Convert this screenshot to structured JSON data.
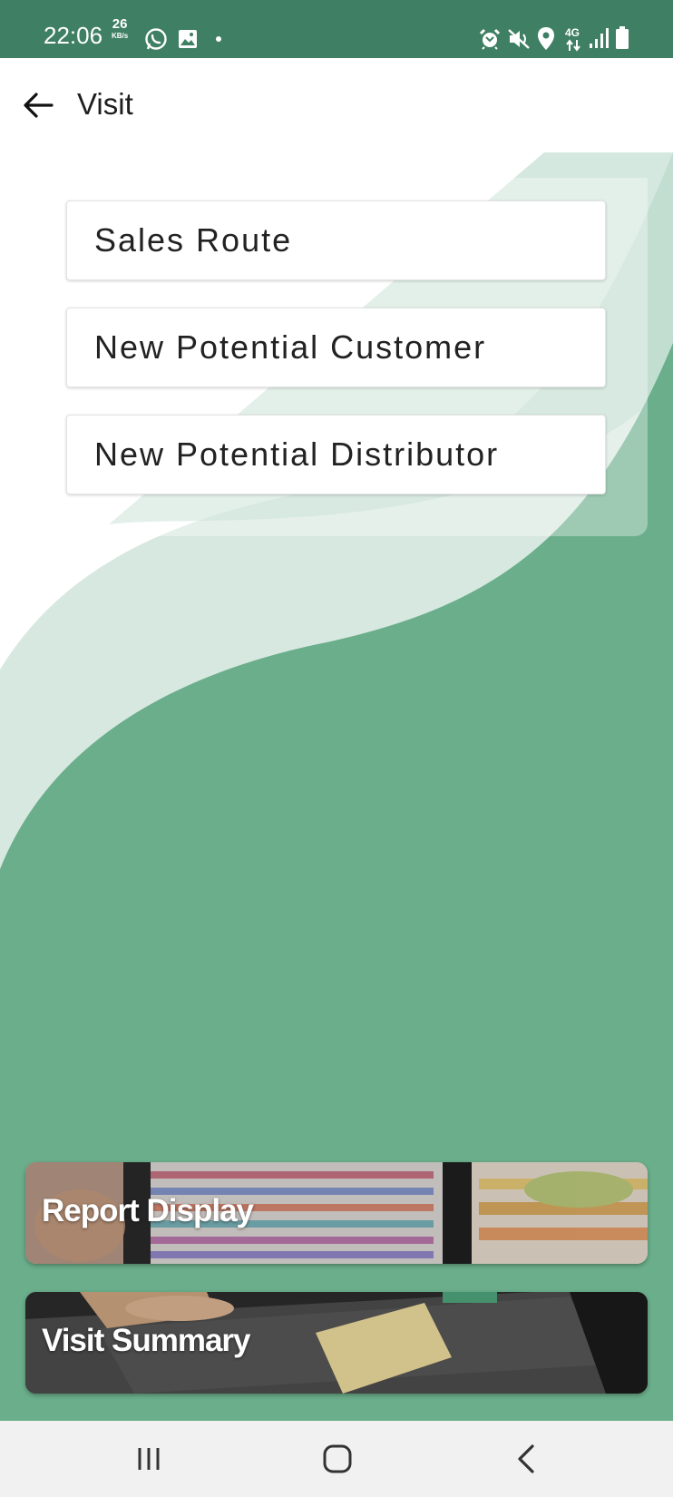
{
  "status_bar": {
    "time": "22:06",
    "net_speed_value": "26",
    "net_speed_unit": "KB/s",
    "left_icons": [
      "whatsapp-icon",
      "gallery-icon",
      "dot-icon"
    ],
    "right_icons": [
      "alarm-icon",
      "mute-icon",
      "location-icon",
      "4g-icon",
      "signal-icon",
      "battery-icon"
    ],
    "network_label": "4G"
  },
  "header": {
    "title": "Visit",
    "back_icon": "arrow-left-icon"
  },
  "menu": {
    "items": [
      {
        "label": "Sales Route"
      },
      {
        "label": "New Potential Customer"
      },
      {
        "label": "New Potential Distributor"
      }
    ]
  },
  "cards": [
    {
      "label": "Report Display",
      "image": "supermarket-shelves-photo"
    },
    {
      "label": "Visit Summary",
      "image": "clipboard-document-photo"
    }
  ],
  "nav_bar": {
    "buttons": [
      "recents-icon",
      "home-icon",
      "back-icon"
    ]
  },
  "colors": {
    "status_bar": "#3f7f63",
    "wave_light": "#d7e8e0",
    "wave_mid": "#b0d6c4",
    "wave_dark": "#6aae8b",
    "nav_bar": "#f1f1f1"
  }
}
